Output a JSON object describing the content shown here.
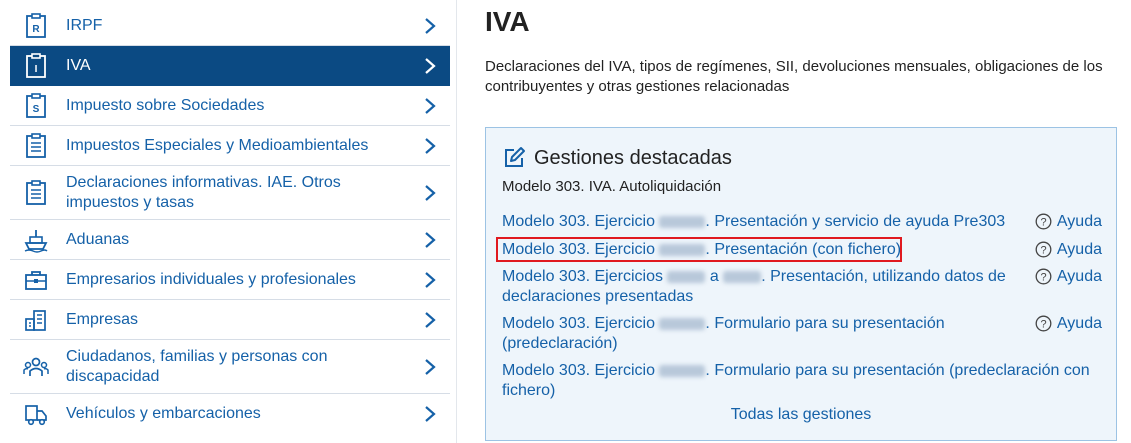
{
  "sidebar": {
    "items": [
      {
        "label": "IRPF",
        "icon": "form-r-icon"
      },
      {
        "label": "IVA",
        "icon": "form-i-icon"
      },
      {
        "label": "Impuesto sobre Sociedades",
        "icon": "form-s-icon"
      },
      {
        "label": "Impuestos Especiales y Medioambientales",
        "icon": "document-icon"
      },
      {
        "label": "Declaraciones informativas. IAE. Otros impuestos y tasas",
        "icon": "document-icon"
      },
      {
        "label": "Aduanas",
        "icon": "ship-icon"
      },
      {
        "label": "Empresarios individuales y profesionales",
        "icon": "briefcase-icon"
      },
      {
        "label": "Empresas",
        "icon": "buildings-icon"
      },
      {
        "label": "Ciudadanos, familias y personas con discapacidad",
        "icon": "people-icon"
      },
      {
        "label": "Vehículos y embarcaciones",
        "icon": "vehicle-icon"
      }
    ],
    "active_color": "#0b4a83",
    "link_color": "#1561a8"
  },
  "main": {
    "title": "IVA",
    "description": "Declaraciones del IVA, tipos de regímenes, SII, devoluciones mensuales, obligaciones de los contribuyentes y otras gestiones relacionadas"
  },
  "panel": {
    "title": "Gestiones destacadas",
    "subtitle": "Modelo 303. IVA. Autoliquidación",
    "links": [
      {
        "a": "Modelo 303. Ejercicio ",
        "b": ". Presentación y servicio de ayuda Pre303",
        "help": "Ayuda"
      },
      {
        "a": "Modelo 303. Ejercicio ",
        "b": ". Presentación (con fichero)",
        "help": "Ayuda"
      },
      {
        "a": "Modelo 303. Ejercicios ",
        "mid": " a ",
        "b": ". Presentación, utilizando datos de declaraciones presentadas",
        "help": "Ayuda"
      },
      {
        "a": "Modelo 303. Ejercicio ",
        "b": ". Formulario para su presentación (predeclaración)",
        "help": "Ayuda"
      },
      {
        "a": "Modelo 303. Ejercicio ",
        "b": ". Formulario para su presentación (predeclaración con fichero)"
      }
    ],
    "all_link": "Todas las gestiones",
    "highlight_color": "#e0191f"
  }
}
